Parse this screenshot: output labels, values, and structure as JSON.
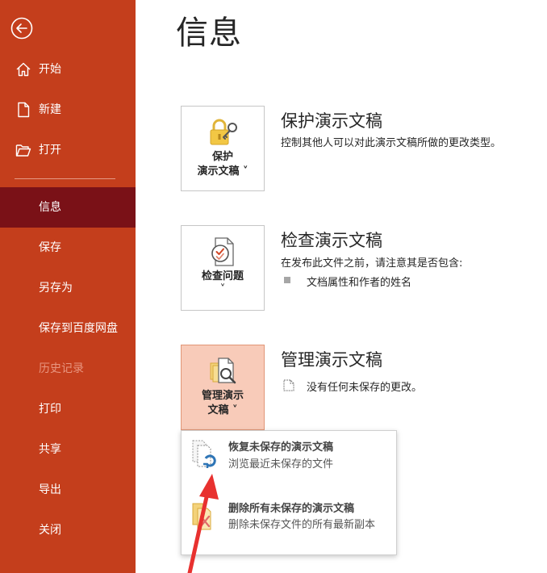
{
  "sidebar": {
    "items": [
      {
        "label": "开始",
        "icon": "home-icon"
      },
      {
        "label": "新建",
        "icon": "new-document-icon"
      },
      {
        "label": "打开",
        "icon": "folder-open-icon"
      },
      {
        "label": "信息",
        "active": true
      },
      {
        "label": "保存"
      },
      {
        "label": "另存为"
      },
      {
        "label": "保存到百度网盘"
      },
      {
        "label": "历史记录",
        "disabled": true
      },
      {
        "label": "打印"
      },
      {
        "label": "共享"
      },
      {
        "label": "导出"
      },
      {
        "label": "关闭"
      }
    ],
    "bg_color": "#c43e1c",
    "active_color": "#7a1117"
  },
  "main": {
    "title": "信息",
    "protect": {
      "tile_line1": "保护",
      "tile_line2": "演示文稿 ˅",
      "title": "保护演示文稿",
      "desc": "控制其他人可以对此演示文稿所做的更改类型。"
    },
    "inspect": {
      "tile_line1": "检查问题",
      "tile_line2": "˅",
      "title": "检查演示文稿",
      "desc": "在发布此文件之前，请注意其是否包含:",
      "bullet": "文档属性和作者的姓名"
    },
    "manage": {
      "tile_line1": "管理演示",
      "tile_line2": "文稿 ˅",
      "title": "管理演示文稿",
      "desc": "没有任何未保存的更改。"
    }
  },
  "dropdown": {
    "recover_title": "恢复未保存的演示文稿",
    "recover_sub": "浏览最近未保存的文件",
    "delete_title": "删除所有未保存的演示文稿",
    "delete_sub": "删除未保存文件的所有最新副本"
  },
  "colors": {
    "accent": "#c43e1c",
    "selected_tile": "#f8cbb9",
    "arrow": "#e8312f"
  }
}
